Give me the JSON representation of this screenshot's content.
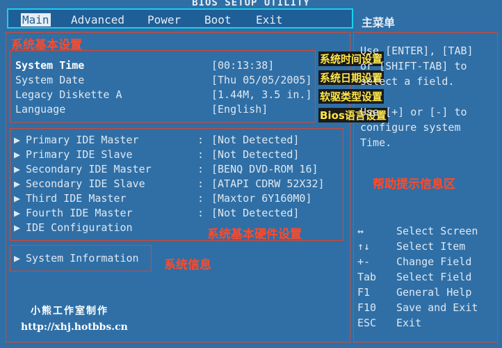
{
  "bios": {
    "title": "BIOS SETUP UTILITY",
    "menu": [
      "Main",
      "Advanced",
      "Power",
      "Boot",
      "Exit"
    ],
    "main_menu_cn": "主菜单"
  },
  "annotations": {
    "basic_settings": "系统基本设置",
    "time_setting": "系统时间设置",
    "date_setting": "系统日期设置",
    "floppy_setting": "软驱类型设置",
    "language_setting": "Bios语言设置",
    "hardware_settings": "系统基本硬件设置",
    "system_info": "系统信息",
    "help_area": "帮助提示信息区"
  },
  "basic_items": [
    {
      "label": "System Time",
      "value": "[00:13:38]"
    },
    {
      "label": "System Date",
      "value": "[Thu 05/05/2005]"
    },
    {
      "label": "Legacy Diskette A",
      "value": "[1.44M, 3.5 in.]"
    },
    {
      "label": "Language",
      "value": "[English]"
    }
  ],
  "ide_items": [
    {
      "label": "Primary IDE Master",
      "value": "[Not Detected]"
    },
    {
      "label": "Primary IDE Slave",
      "value": "[Not Detected]"
    },
    {
      "label": "Secondary IDE Master",
      "value": "[BENQ     DVD-ROM 16]"
    },
    {
      "label": "Secondary IDE Slave",
      "value": "[ATAPI    CDRW 52X32]"
    },
    {
      "label": "Third IDE Master",
      "value": "[Maxtor 6Y160M0]"
    },
    {
      "label": "Fourth IDE Master",
      "value": "[Not Detected]"
    },
    {
      "label": "IDE Configuration",
      "value": ""
    }
  ],
  "system_information": "System Information",
  "help": {
    "line1": "Use [ENTER], [TAB]",
    "line2": "or [SHIFT-TAB] to",
    "line3": "select a field.",
    "line4": "Use [+] or [-] to",
    "line5": "configure system Time."
  },
  "keys": [
    {
      "key": "↔",
      "desc": "Select Screen"
    },
    {
      "key": "↑↓",
      "desc": "Select Item"
    },
    {
      "key": "+-",
      "desc": "Change Field"
    },
    {
      "key": "Tab",
      "desc": "Select Field"
    },
    {
      "key": "F1",
      "desc": "General Help"
    },
    {
      "key": "F10",
      "desc": "Save and Exit"
    },
    {
      "key": "ESC",
      "desc": "Exit"
    }
  ],
  "credit": {
    "name": "小熊工作室制作",
    "url": "http://xhj.hotbbs.cn"
  }
}
